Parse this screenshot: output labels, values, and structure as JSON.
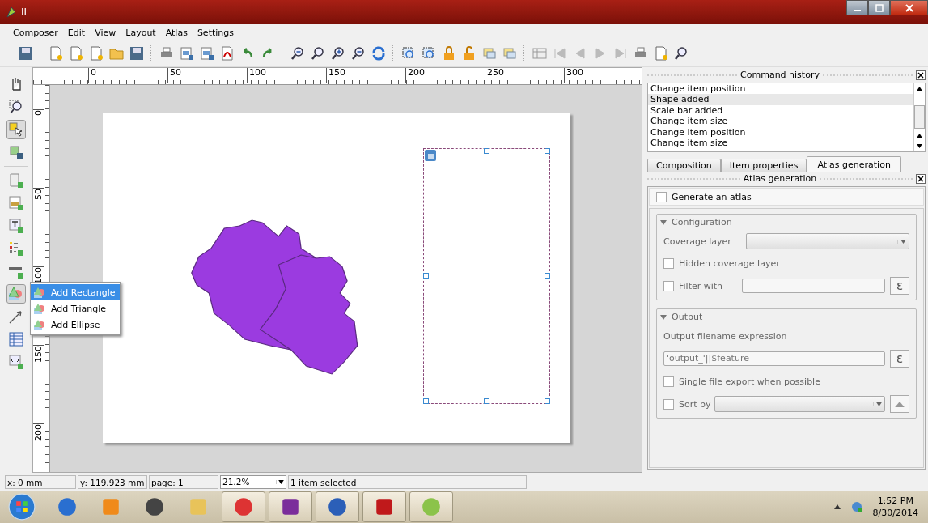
{
  "window": {
    "title": "II"
  },
  "menu": [
    "Composer",
    "Edit",
    "View",
    "Layout",
    "Atlas",
    "Settings"
  ],
  "ruler": {
    "horizontal": [
      "0",
      "50",
      "100",
      "150",
      "200",
      "250",
      "300"
    ],
    "vertical": [
      "0",
      "50",
      "100",
      "150",
      "200"
    ]
  },
  "shape_menu": [
    {
      "label": "Add Rectangle",
      "selected": true
    },
    {
      "label": "Add Triangle",
      "selected": false
    },
    {
      "label": "Add Ellipse",
      "selected": false
    }
  ],
  "command_history": {
    "title": "Command history",
    "items": [
      {
        "label": "Change item position",
        "selected": false
      },
      {
        "label": "Shape added",
        "selected": true
      },
      {
        "label": "Scale bar added",
        "selected": false
      },
      {
        "label": "Change item size",
        "selected": false
      },
      {
        "label": "Change item position",
        "selected": false
      },
      {
        "label": "Change item size",
        "selected": false
      }
    ]
  },
  "tabs": [
    {
      "label": "Composition",
      "selected": false
    },
    {
      "label": "Item properties",
      "selected": false
    },
    {
      "label": "Atlas generation",
      "selected": true
    }
  ],
  "atlas": {
    "title": "Atlas generation",
    "generate": {
      "label": "Generate an atlas",
      "checked": false
    },
    "configuration": {
      "title": "Configuration",
      "expanded": true,
      "coverage_label": "Coverage layer",
      "hidden": {
        "label": "Hidden coverage layer",
        "checked": false
      },
      "filter": {
        "label": "Filter with",
        "checked": false
      },
      "expression_button": "ε"
    },
    "output": {
      "title": "Output",
      "expanded": true,
      "expression_label": "Output filename expression",
      "expression_value": "'output_'||$feature",
      "expression_button": "ε",
      "single": {
        "label": "Single file export when possible",
        "checked": false
      },
      "sort": {
        "label": "Sort by",
        "checked": false
      }
    }
  },
  "status_bar": {
    "x": "x: 0 mm",
    "y": "y: 119.923 mm",
    "page": "page: 1",
    "zoom": "21.2%",
    "message": "1 item selected"
  },
  "taskbar": {
    "time": "1:52 PM",
    "date": "8/30/2014"
  }
}
